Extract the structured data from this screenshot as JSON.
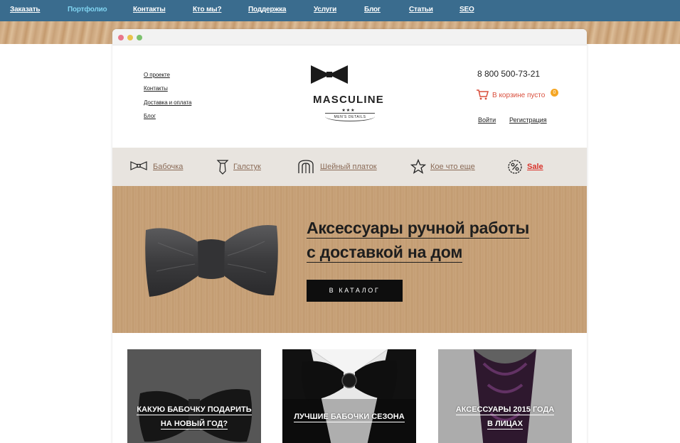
{
  "topnav": {
    "items": [
      {
        "label": "Заказать",
        "active": false
      },
      {
        "label": "Портфолио",
        "active": true
      },
      {
        "label": "Контакты",
        "active": false
      },
      {
        "label": "Кто мы?",
        "active": false
      },
      {
        "label": "Поддержка",
        "active": false
      },
      {
        "label": "Услуги",
        "active": false
      },
      {
        "label": "Блог",
        "active": false
      },
      {
        "label": "Статьи",
        "active": false
      },
      {
        "label": "SEO",
        "active": false
      }
    ]
  },
  "header": {
    "links": [
      "О проекте",
      "Контакты",
      "Доставка и оплата",
      "Блог"
    ],
    "logo": {
      "brand": "MASCULINE",
      "stars": "★★★",
      "tagline": "MEN'S DETAILS",
      "icon": "bow-tie-icon"
    },
    "phone": "8 800 500-73-21",
    "cart": {
      "text": "В корзине пусто",
      "count": "0",
      "icon": "cart-icon"
    },
    "login": "Войти",
    "register": "Регистрация"
  },
  "categories": [
    {
      "label": "Бабочка",
      "icon": "bow-tie-icon"
    },
    {
      "label": "Галстук",
      "icon": "tie-icon"
    },
    {
      "label": "Шейный платок",
      "icon": "scarf-icon"
    },
    {
      "label": "Кое что еще",
      "icon": "star-icon"
    },
    {
      "label": "Sale",
      "icon": "percent-badge-icon"
    }
  ],
  "hero": {
    "line1": "Аксессуары ручной работы",
    "line2": "с доставкой на дом",
    "cta": "В КАТАЛОГ"
  },
  "tiles": [
    {
      "line1": "КАКУЮ БАБОЧКУ ПОДАРИТЬ",
      "line2": "НА НОВЫЙ ГОД?"
    },
    {
      "line1": "ЛУЧШИЕ БАБОЧКИ СЕЗОНА"
    },
    {
      "line1": "АКСЕССУАРЫ 2015 ГОДА",
      "line2": "В ЛИЦАХ"
    }
  ],
  "colors": {
    "topnav_bg": "#3a6c8e",
    "active_link": "#7fd3f0",
    "cart_text": "#d94e3c",
    "cart_badge": "#f5a623",
    "sale": "#d9322a",
    "category_bar": "#e8e4df",
    "cta_bg": "#0e0e0e"
  }
}
